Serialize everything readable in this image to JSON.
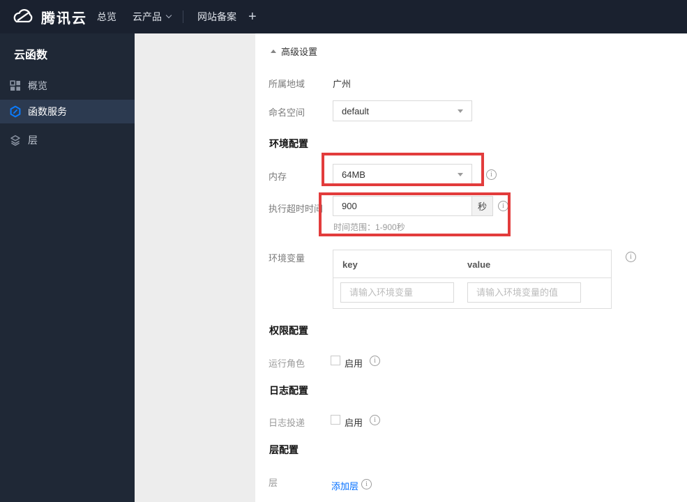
{
  "colors": {
    "nav_bg": "#1a212f",
    "sidebar_bg": "#1f2836",
    "sidebar_selected_bg": "#2c3a50",
    "brand_blue": "#006eff",
    "function_icon_blue": "#0a7cff",
    "annotation_red": "#e23c3c",
    "panel_gray": "#ededed"
  },
  "nav": {
    "brand": "腾讯云",
    "overview": "总览",
    "products": "云产品",
    "icp": "网站备案",
    "plus": "+"
  },
  "sidebar": {
    "title": "云函数",
    "items": [
      {
        "label": "概览"
      },
      {
        "label": "函数服务"
      },
      {
        "label": "层"
      }
    ]
  },
  "content": {
    "advanced_toggle": "高级设置",
    "region_label": "所属地域",
    "region_value": "广州",
    "namespace_label": "命名空间",
    "namespace_value": "default",
    "section_env": "环境配置",
    "memory_label": "内存",
    "memory_value": "64MB",
    "timeout_label": "执行超时时间",
    "timeout_value": "900",
    "timeout_unit": "秒",
    "timeout_hint": "时间范围：1-900秒",
    "envvar_label": "环境变量",
    "envvar_key_header": "key",
    "envvar_value_header": "value",
    "envvar_key_placeholder": "请输入环境变量",
    "envvar_value_placeholder": "请输入环境变量的值",
    "section_perm": "权限配置",
    "role_label": "运行角色",
    "role_enable": "启用",
    "section_log": "日志配置",
    "logship_label": "日志投递",
    "logship_enable": "启用",
    "section_layer": "层配置",
    "layer_label": "层",
    "layer_add_link": "添加层"
  }
}
